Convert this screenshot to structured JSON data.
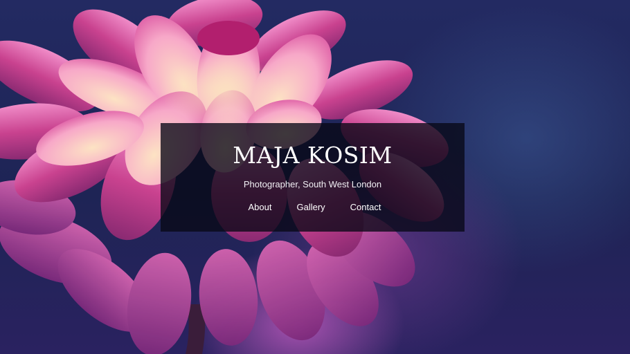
{
  "site": {
    "title": "MAJA KOSIM",
    "tagline": "Photographer, South West London"
  },
  "nav": {
    "items": [
      {
        "label": "About"
      },
      {
        "label": "Gallery"
      },
      {
        "label": "Contact"
      }
    ]
  },
  "colors": {
    "background": "#1f2458",
    "overlay": "rgba(8, 8, 22, 0.78)",
    "text": "#ffffff",
    "petal_pink": "#d84f9c",
    "petal_light": "#fbd7b8"
  },
  "image": {
    "subject_icon": "dahlia-flower-photo"
  }
}
